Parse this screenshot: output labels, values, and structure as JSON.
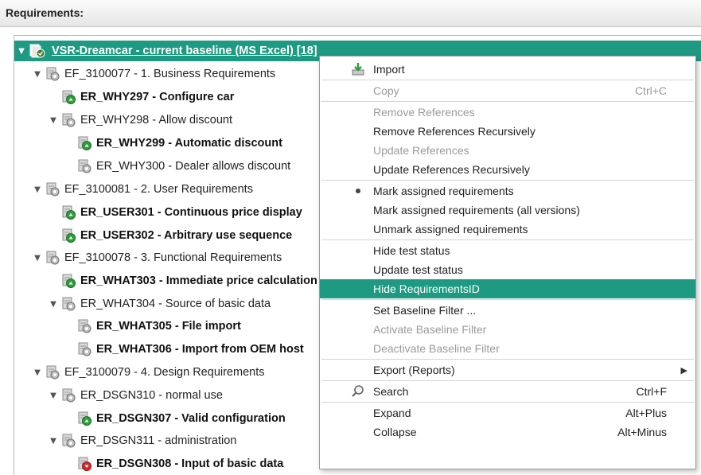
{
  "header": {
    "title": "Requirements:"
  },
  "tree": [
    {
      "label": "VSR-Dreamcar - current baseline (MS Excel) [18]",
      "level": 0,
      "twisty": "▼",
      "bold": true,
      "root": true,
      "icon": "baseline-icon"
    },
    {
      "label": "EF_3100077 - 1. Business Requirements",
      "level": 1,
      "twisty": "▼",
      "bold": false,
      "icon": "folder-requirement-icon"
    },
    {
      "label": "ER_WHY297 - Configure car",
      "level": 2,
      "twisty": "",
      "bold": true,
      "icon": "requirement-passed-icon"
    },
    {
      "label": "ER_WHY298 - Allow discount",
      "level": 2,
      "twisty": "▼",
      "bold": false,
      "icon": "folder-requirement-icon"
    },
    {
      "label": "ER_WHY299 - Automatic discount",
      "level": 3,
      "twisty": "",
      "bold": true,
      "icon": "requirement-passed-icon"
    },
    {
      "label": "ER_WHY300 - Dealer allows discount",
      "level": 3,
      "twisty": "",
      "bold": false,
      "icon": "requirement-neutral-icon"
    },
    {
      "label": "EF_3100081 - 2. User Requirements",
      "level": 1,
      "twisty": "▼",
      "bold": false,
      "icon": "folder-requirement-icon"
    },
    {
      "label": "ER_USER301 - Continuous price display",
      "level": 2,
      "twisty": "",
      "bold": true,
      "icon": "requirement-passed-icon"
    },
    {
      "label": "ER_USER302 - Arbitrary use sequence",
      "level": 2,
      "twisty": "",
      "bold": true,
      "icon": "requirement-passed-icon"
    },
    {
      "label": "EF_3100078 - 3. Functional Requirements",
      "level": 1,
      "twisty": "▼",
      "bold": false,
      "icon": "folder-requirement-icon"
    },
    {
      "label": "ER_WHAT303 - Immediate price calculation",
      "level": 2,
      "twisty": "",
      "bold": true,
      "icon": "requirement-passed-icon"
    },
    {
      "label": "ER_WHAT304 - Source of basic data",
      "level": 2,
      "twisty": "▼",
      "bold": false,
      "icon": "folder-requirement-icon"
    },
    {
      "label": "ER_WHAT305 - File import",
      "level": 3,
      "twisty": "",
      "bold": true,
      "icon": "requirement-neutral-icon"
    },
    {
      "label": "ER_WHAT306 - Import from OEM host",
      "level": 3,
      "twisty": "",
      "bold": true,
      "icon": "requirement-neutral-icon"
    },
    {
      "label": "EF_3100079 - 4. Design Requirements",
      "level": 1,
      "twisty": "▼",
      "bold": false,
      "icon": "folder-requirement-icon"
    },
    {
      "label": "ER_DSGN310 - normal use",
      "level": 2,
      "twisty": "▼",
      "bold": false,
      "icon": "folder-requirement-icon"
    },
    {
      "label": "ER_DSGN307 - Valid configuration",
      "level": 3,
      "twisty": "",
      "bold": true,
      "icon": "requirement-passed-icon"
    },
    {
      "label": "ER_DSGN311 - administration",
      "level": 2,
      "twisty": "▼",
      "bold": false,
      "icon": "folder-requirement-icon"
    },
    {
      "label": "ER_DSGN308 - Input of basic data",
      "level": 3,
      "twisty": "",
      "bold": true,
      "icon": "requirement-failed-icon"
    }
  ],
  "menu": [
    {
      "type": "item",
      "label": "Import",
      "icon": "import-icon"
    },
    {
      "type": "sep"
    },
    {
      "type": "item",
      "label": "Copy",
      "shortcut": "Ctrl+C",
      "disabled": true
    },
    {
      "type": "sep"
    },
    {
      "type": "item",
      "label": "Remove References",
      "disabled": true
    },
    {
      "type": "item",
      "label": "Remove References Recursively"
    },
    {
      "type": "item",
      "label": "Update References",
      "disabled": true
    },
    {
      "type": "item",
      "label": "Update References Recursively"
    },
    {
      "type": "sep"
    },
    {
      "type": "item",
      "label": "Mark assigned requirements",
      "bullet": true
    },
    {
      "type": "item",
      "label": "Mark assigned requirements (all versions)"
    },
    {
      "type": "item",
      "label": "Unmark assigned requirements"
    },
    {
      "type": "sep"
    },
    {
      "type": "item",
      "label": "Hide test status"
    },
    {
      "type": "item",
      "label": "Update test status"
    },
    {
      "type": "item",
      "label": "Hide RequirementsID",
      "highlight": true
    },
    {
      "type": "sep"
    },
    {
      "type": "item",
      "label": "Set Baseline Filter ..."
    },
    {
      "type": "item",
      "label": "Activate Baseline Filter",
      "disabled": true
    },
    {
      "type": "item",
      "label": "Deactivate Baseline Filter",
      "disabled": true
    },
    {
      "type": "sep"
    },
    {
      "type": "item",
      "label": "Export (Reports)",
      "submenu": true
    },
    {
      "type": "sep"
    },
    {
      "type": "item",
      "label": "Search",
      "shortcut": "Ctrl+F",
      "icon": "search-icon"
    },
    {
      "type": "sep"
    },
    {
      "type": "item",
      "label": "Expand",
      "shortcut": "Alt+Plus"
    },
    {
      "type": "item",
      "label": "Collapse",
      "shortcut": "Alt+Minus"
    }
  ],
  "colors": {
    "accent": "#1e9a82",
    "passed": "#2e9e3a",
    "failed": "#d92626",
    "disabled": "#9a9a9a"
  }
}
